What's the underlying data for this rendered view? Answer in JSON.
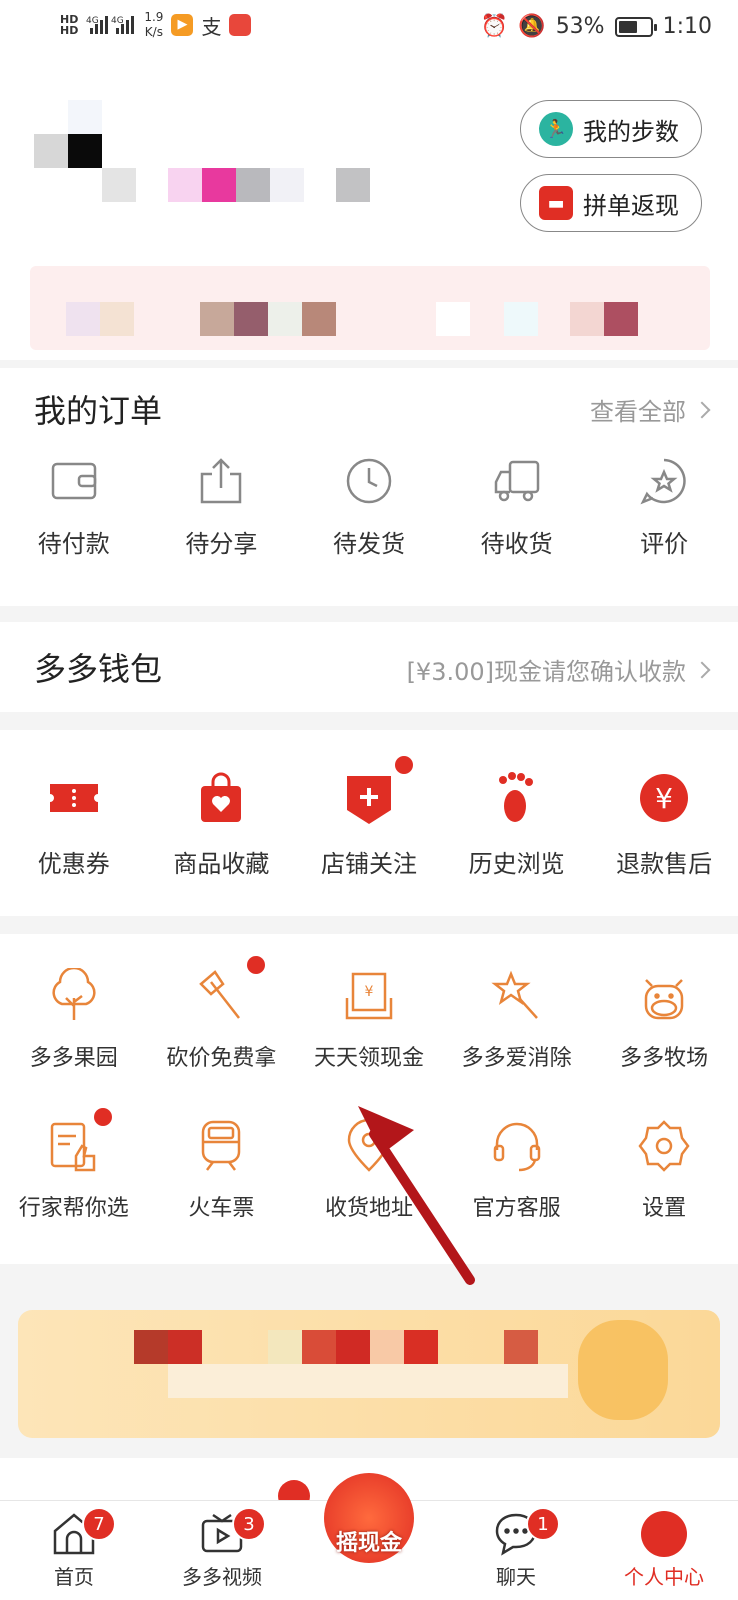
{
  "status": {
    "speed_value": "1.9",
    "speed_unit": "K/s",
    "battery": "53%",
    "time": "1:10",
    "battery_level": 0.53
  },
  "header": {
    "my_steps": "我的步数",
    "group_cashback": "拼单返现"
  },
  "orders": {
    "title": "我的订单",
    "view_all": "查看全部",
    "items": [
      {
        "label": "待付款",
        "icon": "wallet-icon"
      },
      {
        "label": "待分享",
        "icon": "share-icon"
      },
      {
        "label": "待发货",
        "icon": "clock-icon"
      },
      {
        "label": "待收货",
        "icon": "truck-icon"
      },
      {
        "label": "评价",
        "icon": "review-star-icon"
      }
    ]
  },
  "wallet": {
    "title": "多多钱包",
    "notice": "[¥3.00]现金请您确认收款"
  },
  "services": {
    "items": [
      {
        "label": "优惠券",
        "icon": "coupon-icon"
      },
      {
        "label": "商品收藏",
        "icon": "favorite-bag-icon"
      },
      {
        "label": "店铺关注",
        "icon": "store-follow-icon"
      },
      {
        "label": "历史浏览",
        "icon": "footprint-icon"
      },
      {
        "label": "退款售后",
        "icon": "refund-yen-icon"
      }
    ]
  },
  "tools": {
    "row1": [
      {
        "label": "多多果园",
        "icon": "tree-icon"
      },
      {
        "label": "砍价免费拿",
        "icon": "axe-icon"
      },
      {
        "label": "天天领现金",
        "icon": "cash-envelope-icon"
      },
      {
        "label": "多多爱消除",
        "icon": "star-wand-icon"
      },
      {
        "label": "多多牧场",
        "icon": "cow-icon"
      }
    ],
    "row2": [
      {
        "label": "行家帮你选",
        "icon": "expert-pick-icon"
      },
      {
        "label": "火车票",
        "icon": "train-icon"
      },
      {
        "label": "收货地址",
        "icon": "location-icon"
      },
      {
        "label": "官方客服",
        "icon": "headset-icon"
      },
      {
        "label": "设置",
        "icon": "gear-icon"
      }
    ]
  },
  "tabbar": {
    "items": [
      {
        "label": "首页",
        "badge": "7",
        "icon": "home-icon"
      },
      {
        "label": "多多视频",
        "badge": "3",
        "icon": "video-icon"
      },
      {
        "label": "摇现金",
        "badge": "",
        "icon": "shake-cash-icon"
      },
      {
        "label": "聊天",
        "badge": "1",
        "icon": "chat-icon"
      },
      {
        "label": "个人中心",
        "badge": "",
        "icon": "profile-icon"
      }
    ]
  },
  "colors": {
    "accent": "#e02e24",
    "icon_orange": "#e8853a"
  }
}
